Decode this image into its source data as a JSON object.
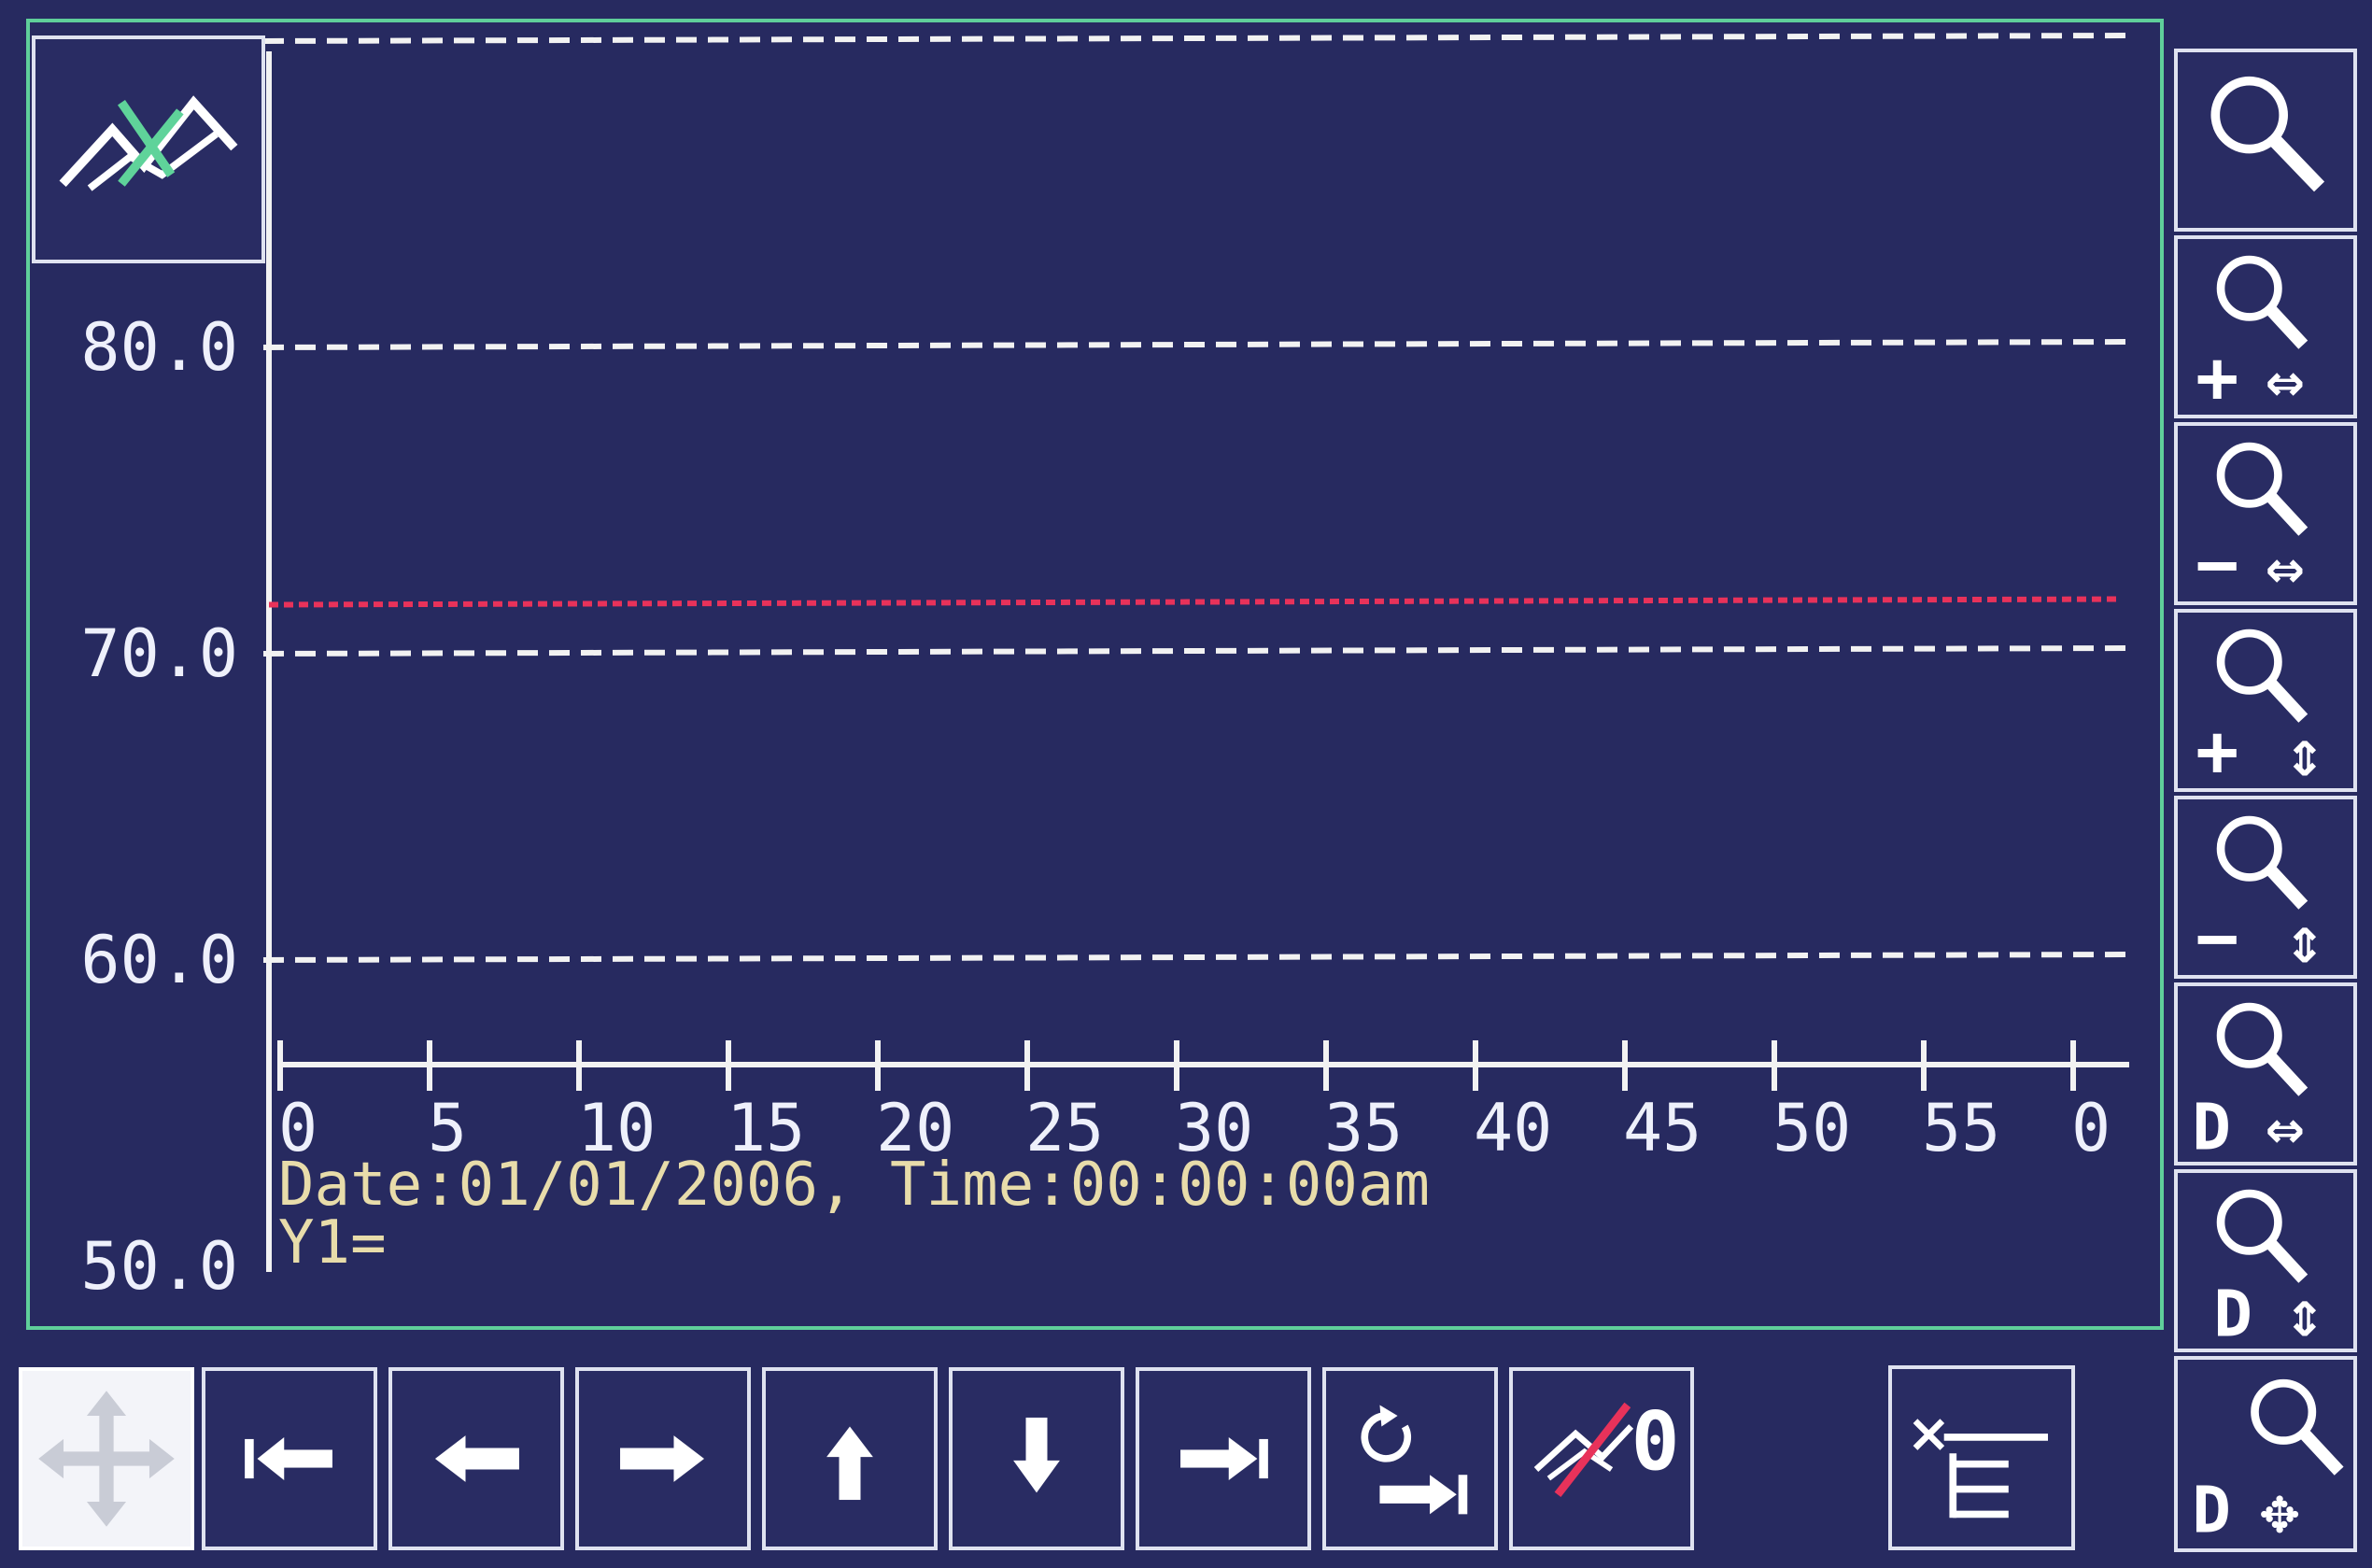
{
  "colors": {
    "background": "#272a60",
    "plot_border": "#5fcf9a",
    "grid": "#f2f2f2",
    "setpoint_line": "#e8325a",
    "status_text": "#e8dcaa",
    "button_border": "#dfe2f0"
  },
  "chart_data": {
    "type": "line",
    "x_ticks": [
      "0",
      "5",
      "10",
      "15",
      "20",
      "25",
      "30",
      "35",
      "40",
      "45",
      "50",
      "55",
      "0"
    ],
    "y_ticks": [
      "80.0",
      "70.0",
      "60.0",
      "50.0"
    ],
    "ylim": [
      50.0,
      90.0
    ],
    "xlim": [
      0,
      60
    ],
    "grid": true,
    "gridline_values": [
      90.0,
      80.0,
      70.0,
      60.0
    ],
    "reference_line": {
      "value": 71.6,
      "color": "#e8325a",
      "style": "dashed"
    },
    "series": []
  },
  "status": {
    "datetime": "Date:01/01/2006, Time:00:00:00am",
    "cursor_value": "Y1="
  },
  "icons": {
    "top_left": "trend-display-icon",
    "right_toolbar": [
      "zoom-icon",
      "zoom-in-horizontal-icon",
      "zoom-out-horizontal-icon",
      "zoom-in-vertical-icon",
      "zoom-out-vertical-icon",
      "default-zoom-horizontal-icon",
      "default-zoom-vertical-icon",
      "default-zoom-both-icon"
    ],
    "bottom_toolbar": [
      "pan-icon",
      "first-icon",
      "left-arrow-icon",
      "right-arrow-icon",
      "up-arrow-icon",
      "down-arrow-icon",
      "last-icon",
      "reset-to-end-icon",
      "clear-trend-icon",
      "cursor-select-icon"
    ]
  },
  "toolbar_glyphs": {
    "zoom_in_h": {
      "sign": "+",
      "axis": "⇔"
    },
    "zoom_out_h": {
      "sign": "−",
      "axis": "⇔"
    },
    "zoom_in_v": {
      "sign": "+",
      "axis": "⇕"
    },
    "zoom_out_v": {
      "sign": "−",
      "axis": "⇕"
    },
    "default_h": {
      "sign": "D",
      "axis": "⇔"
    },
    "default_v": {
      "sign": "D",
      "axis": "⇕"
    },
    "default_both": {
      "sign": "D",
      "axis": "✥"
    },
    "clear_trend_digit": "0"
  }
}
